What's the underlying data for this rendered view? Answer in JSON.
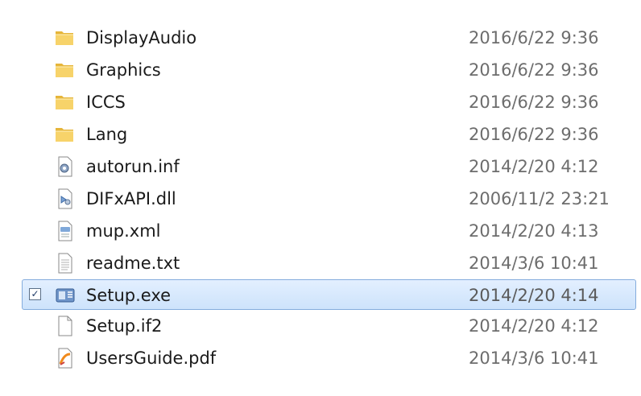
{
  "files": [
    {
      "name": "DisplayAudio",
      "date": "2016/6/22 9:36",
      "icon": "folder-icon",
      "selected": false
    },
    {
      "name": "Graphics",
      "date": "2016/6/22 9:36",
      "icon": "folder-icon",
      "selected": false
    },
    {
      "name": "ICCS",
      "date": "2016/6/22 9:36",
      "icon": "folder-icon",
      "selected": false
    },
    {
      "name": "Lang",
      "date": "2016/6/22 9:36",
      "icon": "folder-icon",
      "selected": false
    },
    {
      "name": "autorun.inf",
      "date": "2014/2/20 4:12",
      "icon": "settings-file-icon",
      "selected": false
    },
    {
      "name": "DIFxAPI.dll",
      "date": "2006/11/2 23:21",
      "icon": "dll-file-icon",
      "selected": false
    },
    {
      "name": "mup.xml",
      "date": "2014/2/20 4:13",
      "icon": "xml-file-icon",
      "selected": false
    },
    {
      "name": "readme.txt",
      "date": "2014/3/6 10:41",
      "icon": "text-file-icon",
      "selected": false
    },
    {
      "name": "Setup.exe",
      "date": "2014/2/20 4:14",
      "icon": "installer-icon",
      "selected": true
    },
    {
      "name": "Setup.if2",
      "date": "2014/2/20 4:12",
      "icon": "blank-file-icon",
      "selected": false
    },
    {
      "name": "UsersGuide.pdf",
      "date": "2014/3/6 10:41",
      "icon": "pdf-file-icon",
      "selected": false
    }
  ],
  "checkbox_mark": "✓",
  "colors": {
    "selection_bg": "#cde3fb",
    "selection_border": "#84acdd",
    "folder": "#f5c94e"
  }
}
